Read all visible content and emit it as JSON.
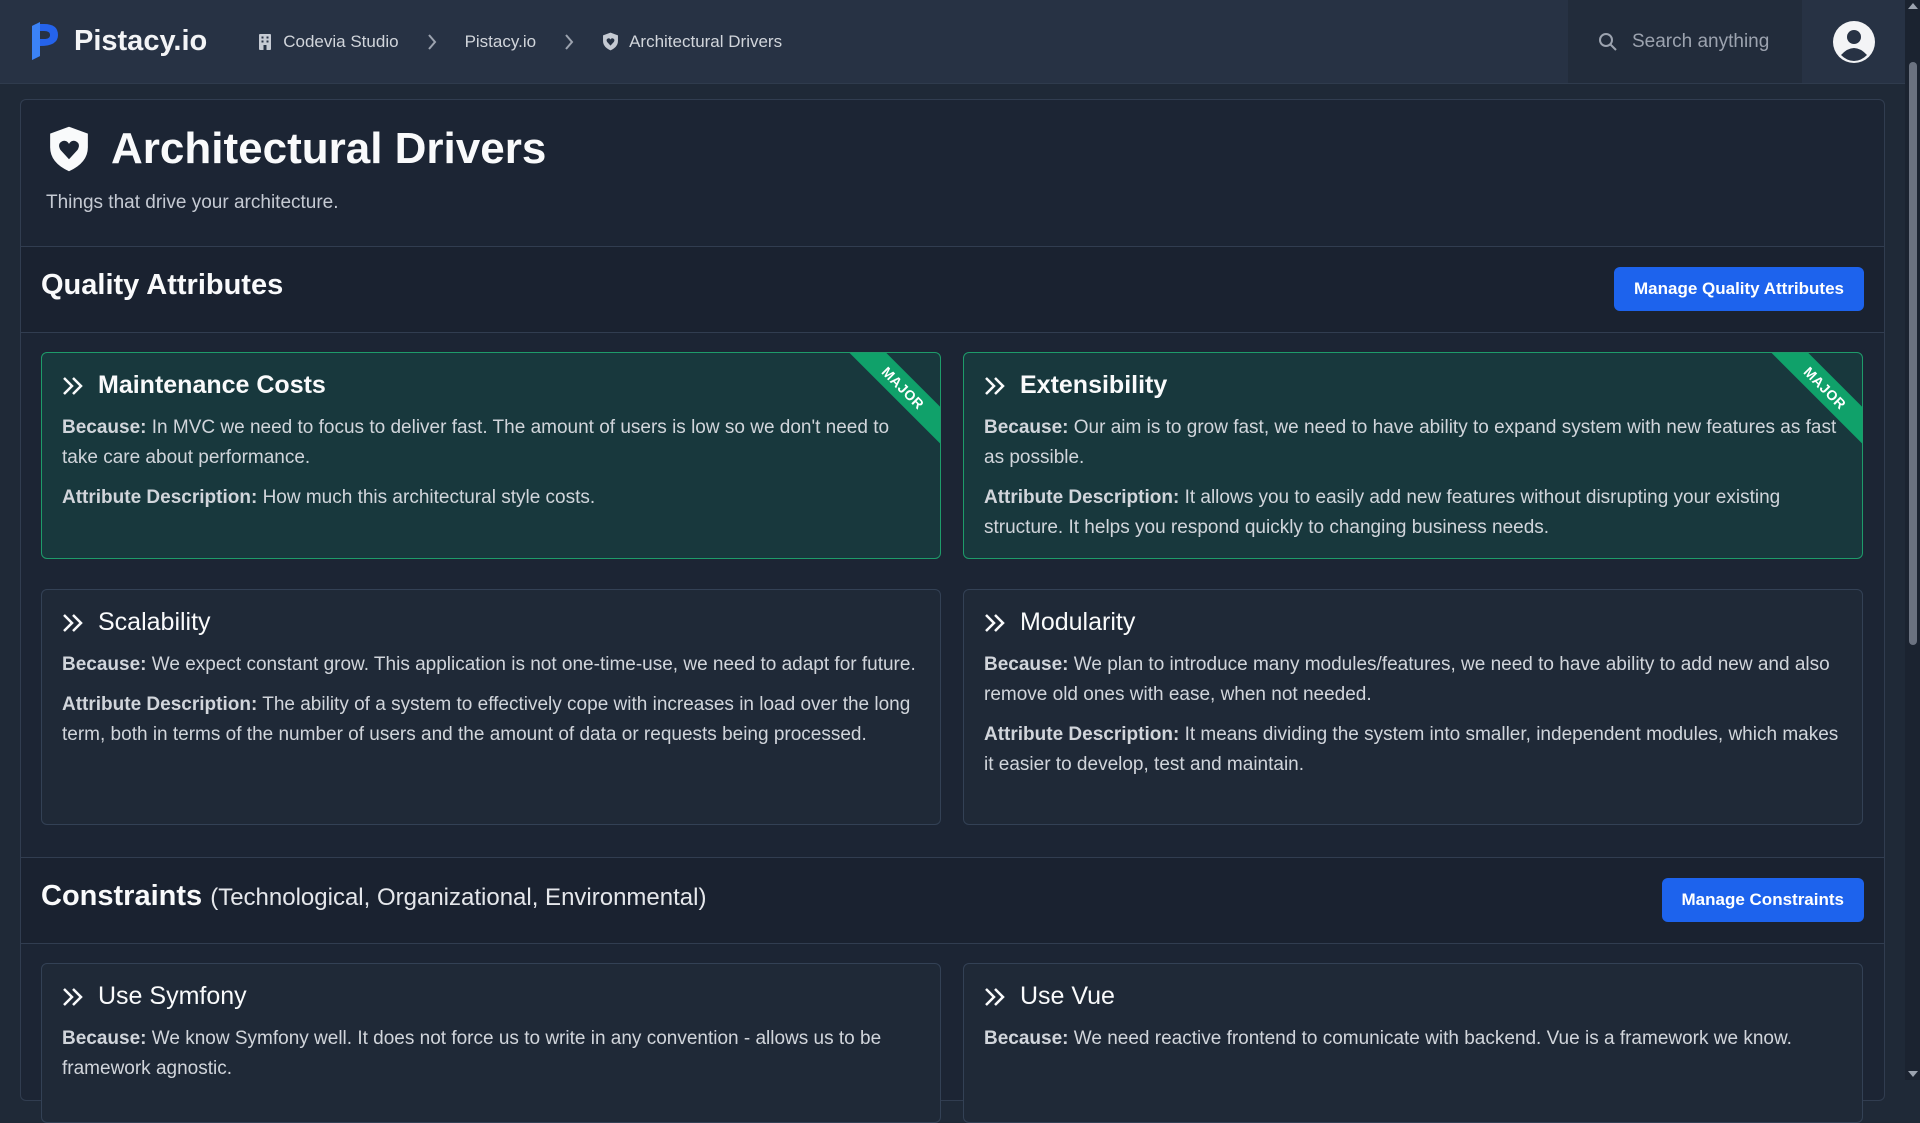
{
  "app": {
    "name": "Pistacy.io"
  },
  "breadcrumb": [
    {
      "label": "Codevia Studio"
    },
    {
      "label": "Pistacy.io"
    },
    {
      "label": "Architectural Drivers"
    }
  ],
  "search": {
    "placeholder": "Search anything"
  },
  "page": {
    "title": "Architectural Drivers",
    "subtitle": "Things that drive your architecture."
  },
  "quality": {
    "title": "Quality Attributes",
    "button": "Manage Quality Attributes",
    "because_label": "Because:",
    "desc_label": "Attribute Description:",
    "cards": [
      {
        "title": "Maintenance Costs",
        "badge": "MAJOR",
        "because": "In MVC we need to focus to deliver fast. The amount of users is low so we don't need to take care about performance.",
        "description": "How much this architectural style costs."
      },
      {
        "title": "Extensibility",
        "badge": "MAJOR",
        "because": "Our aim is to grow fast, we need to have ability to expand system with new features as fast as possible.",
        "description": "It allows you to easily add new features without disrupting your existing structure. It helps you respond quickly to changing business needs."
      },
      {
        "title": "Scalability",
        "because": "We expect constant grow. This application is not one-time-use, we need to adapt for future.",
        "description": "The ability of a system to effectively cope with increases in load over the long term, both in terms of the number of users and the amount of data or requests being processed."
      },
      {
        "title": "Modularity",
        "because": "We plan to introduce many modules/features, we need to have ability to add new and also remove old ones with ease, when not needed.",
        "description": "It means dividing the system into smaller, independent modules, which makes it easier to develop, test and maintain."
      }
    ]
  },
  "constraints": {
    "title": "Constraints",
    "subtitle": "(Technological, Organizational, Environmental)",
    "button": "Manage Constraints",
    "because_label": "Because:",
    "cards": [
      {
        "title": "Use Symfony",
        "because": "We know Symfony well. It does not force us to write in any convention - allows us to be framework agnostic."
      },
      {
        "title": "Use Vue",
        "because": "We need reactive frontend to comunicate with backend. Vue is a framework we know."
      }
    ]
  },
  "colors": {
    "accent": "#1d63ed",
    "major_card_bg": "#18383d",
    "major_ribbon": "#10a16a",
    "background": "#1f2937"
  }
}
